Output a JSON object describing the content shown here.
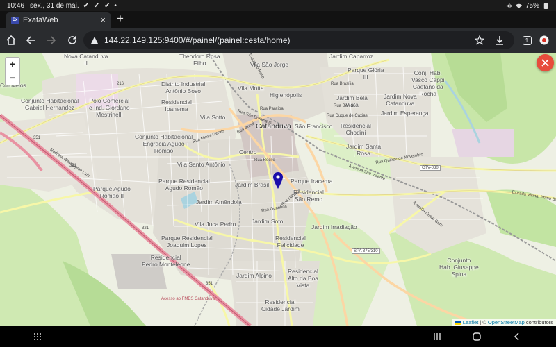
{
  "status_bar": {
    "time": "10:46",
    "date": "sex., 31 de mai.",
    "checks": "✔ ✔ ✔",
    "dot": "•",
    "battery": "75%"
  },
  "browser": {
    "tab_title": "ExataWeb",
    "favicon_text": "Ex",
    "url": "144.22.149.125:9400/#/painel/(painel:cesta/home)",
    "tab_count": "1"
  },
  "map": {
    "zoom_in": "+",
    "zoom_out": "−",
    "attribution": {
      "leaflet": "Leaflet",
      "separator": "| ©",
      "osm": "OpenStreetMap",
      "contributors": "contributors"
    },
    "labels": {
      "theodoro": "Theodoro Rosa\nFilho",
      "nova_catanduva": "Nova Catanduva\nII",
      "jardim_caparroz": "Jardim Caparroz",
      "parque_gloria": "Parque Glória\nIII",
      "vila_sao_jorge": "Vila São Jorge",
      "conj_vasco": "Conj. Hab.\nVasco Cappi\nCaetano da\nRocha",
      "distrito": "Distrito Industrial\nAntônio Boso",
      "vila_motta": "Vila Motta",
      "higienopolis": "Higienópolis",
      "conj_gabriel": "Conjunto Habitacional\nGabriel Hernandez",
      "polo": "Polo Comercial\ne Ind. Giordano\nMestrinelli",
      "residencial_ipanema": "Residencial\nIpanema",
      "jardim_bela_vista": "Jardim Bela\nVista",
      "jardim_nova_catanduva": "Jardim Nova\nCatanduva",
      "jardim_esperanca": "Jardim Esperança",
      "vila_sotto": "Vila Sotto",
      "catanduva": "Catanduva",
      "sao_francisco": "São Francisco",
      "residencial_chodini": "Residencial\nChodini",
      "conj_engracia": "Conjunto Habitacional\nEngrácia Agudo\nRomão",
      "centro": "Centro",
      "jardim_santa_rosa": "Jardim Santa\nRosa",
      "vila_santo_antonio": "Vila Santo Antônio",
      "parque_res_agudo": "Parque Residencial\nAgudo Romão",
      "jardim_brasil": "Jardim Brasil",
      "parque_iracema": "Parque Iracema",
      "parque_agudo_ii": "Parque Agudo\nRomão II",
      "residencial_sao_remo": "Residencial\nSão Remo",
      "jardim_amendola": "Jardim Amêndola",
      "vila_jucca": "Vila Juca Pedro",
      "jardim_soto": "Jardim Soto",
      "jardim_irradiacao": "Jardim Irradiação",
      "parque_joaquim": "Parque Residencial\nJoaquim Lopes",
      "res_felicidade": "Residencial\nFelicidade",
      "res_pedro": "Residencial\nPedro Monteleone",
      "conj_guiseppe": "Conjunto\nHab. Giuseppe\nSpina",
      "jardim_alpino": "Jardim Alpino",
      "res_alto": "Residencial\nAlto da Boa\nVista",
      "res_cidade": "Residencial\nCidade Jardim",
      "cotovelo": "Cotovelos"
    },
    "road_labels": {
      "spa": "SPA 375/310",
      "ctv": "CTV-030",
      "r216": "216",
      "r351": "351",
      "r351a": "351",
      "r321": "321",
      "r321b": "321",
      "rua_sao_domingos": "Rua São Domingos",
      "rua_paraiba": "Rua Paraíba",
      "rua_minas": "Rua Minas Gerais",
      "rua_brasil": "Rua Brasil",
      "rua_recife": "Rua Recife",
      "rua_duque": "Rua Duque de Caxias",
      "rua_novembro": "Rua Quinze de Novembro",
      "rod_washington": "Rodovia Washington Luís",
      "estrada": "Estrada Vicinal Primo Bo",
      "acesso": "Acesso ao FMES Catanduva",
      "rua_nitheroi": "Rua Nitheroi",
      "rua_ourinhos": "Rua Ourinhos",
      "rua_cesar": "Avenida Cesar Gurti",
      "rua_brasilia": "Rua Brasília",
      "rua_belem": "Rua Belém",
      "rodovia_teodoro": "Rodovia Theodoro Rosa",
      "avenida_sao_vicente": "Avenida Sao Vicente"
    }
  }
}
